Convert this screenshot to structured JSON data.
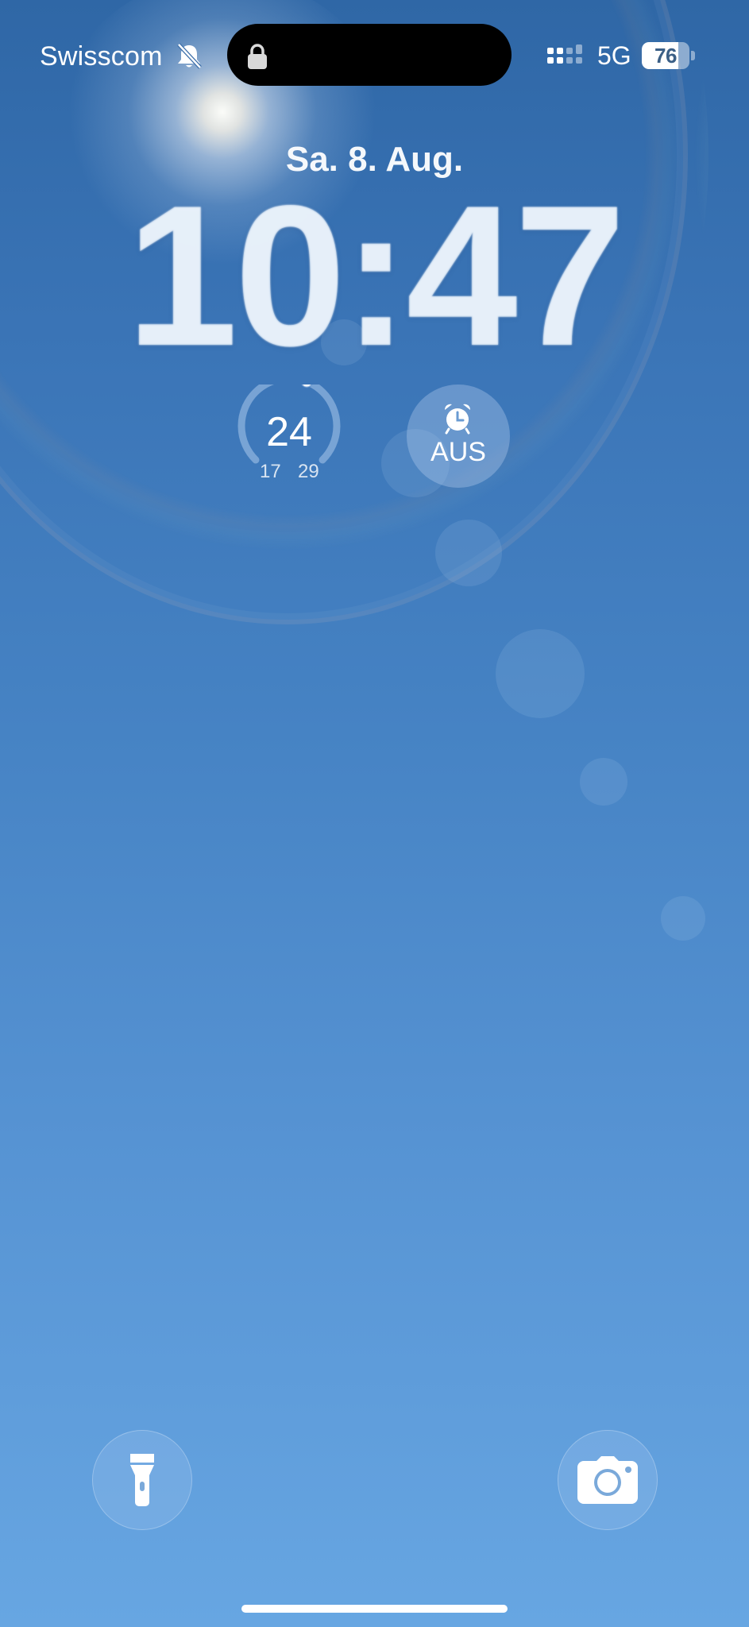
{
  "status_bar": {
    "carrier": "Swisscom",
    "network": "5G",
    "battery_level": "76",
    "battery_fraction": 0.76,
    "icons": [
      "bell-slash-icon",
      "lock-icon",
      "signal-icon"
    ]
  },
  "lock_screen": {
    "date": "Sa. 8. Aug.",
    "time": "10:47"
  },
  "widgets": {
    "weather": {
      "current_temp": "24",
      "low": "17",
      "high": "29",
      "range_fraction": 0.58
    },
    "alarm": {
      "icon": "alarm-clock-icon",
      "label": "AUS"
    }
  },
  "quick_actions": {
    "left": "flashlight-icon",
    "right": "camera-icon"
  },
  "colors": {
    "accent": "#ffffff",
    "background_top": "#2f67a6",
    "background_bottom": "#67a6e2"
  }
}
